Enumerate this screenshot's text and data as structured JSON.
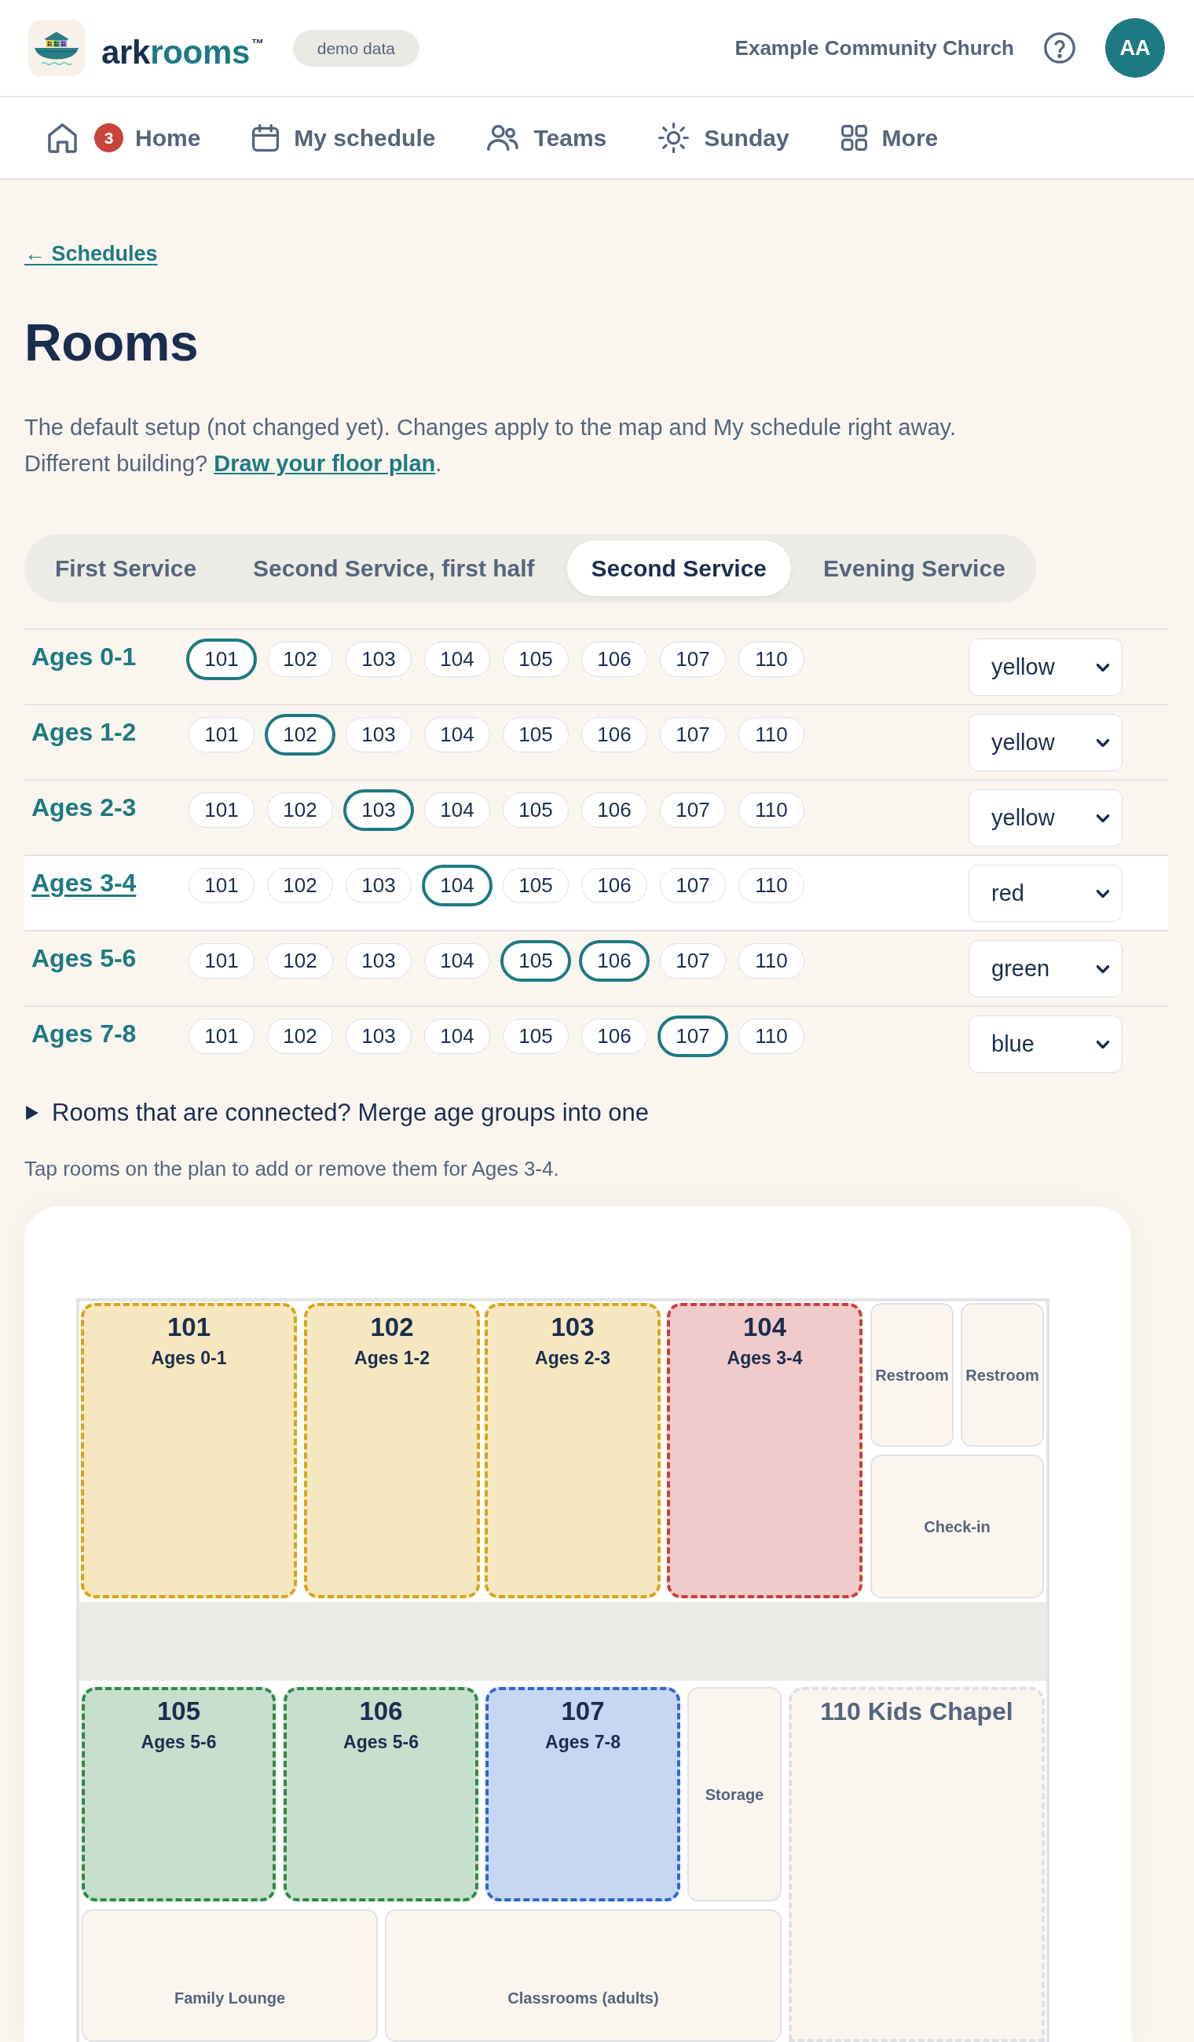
{
  "header": {
    "brand": {
      "first": "ark",
      "second": "rooms",
      "trademark": "™"
    },
    "mode_tag": "demo data",
    "organization": "Example Community Church",
    "avatar": "AA"
  },
  "nav": [
    {
      "kind": "home",
      "label": "Home",
      "badge": "3"
    },
    {
      "kind": "schedule",
      "label": "My schedule"
    },
    {
      "kind": "teams",
      "label": "Teams"
    },
    {
      "kind": "sunday",
      "label": "Sunday"
    },
    {
      "kind": "more",
      "label": "More"
    }
  ],
  "back_link": "← Schedules",
  "title": "Rooms",
  "description": {
    "sentence": "The default setup (not changed yet). Changes apply to the map and My schedule right away.",
    "question": "Different building?",
    "link": "Draw your floor plan",
    "end": "."
  },
  "service_tabs": [
    {
      "label": "First Service",
      "selected": false
    },
    {
      "label": "Second Service, first half",
      "selected": false
    },
    {
      "label": "Second Service",
      "selected": true
    },
    {
      "label": "Evening Service",
      "selected": false
    }
  ],
  "age_groups": [
    {
      "label": "Ages 0-1",
      "selected": false,
      "rooms": [
        {
          "number": "101",
          "selected": true
        },
        {
          "number": "102",
          "selected": false
        },
        {
          "number": "103",
          "selected": false
        },
        {
          "number": "104",
          "selected": false
        },
        {
          "number": "105",
          "selected": false
        },
        {
          "number": "106",
          "selected": false
        },
        {
          "number": "107",
          "selected": false
        },
        {
          "number": "110",
          "selected": false
        }
      ],
      "color_choice": "yellow"
    },
    {
      "label": "Ages 1-2",
      "selected": false,
      "rooms": [
        {
          "number": "101",
          "selected": false
        },
        {
          "number": "102",
          "selected": true
        },
        {
          "number": "103",
          "selected": false
        },
        {
          "number": "104",
          "selected": false
        },
        {
          "number": "105",
          "selected": false
        },
        {
          "number": "106",
          "selected": false
        },
        {
          "number": "107",
          "selected": false
        },
        {
          "number": "110",
          "selected": false
        }
      ],
      "color_choice": "yellow"
    },
    {
      "label": "Ages 2-3",
      "selected": false,
      "rooms": [
        {
          "number": "101",
          "selected": false
        },
        {
          "number": "102",
          "selected": false
        },
        {
          "number": "103",
          "selected": true
        },
        {
          "number": "104",
          "selected": false
        },
        {
          "number": "105",
          "selected": false
        },
        {
          "number": "106",
          "selected": false
        },
        {
          "number": "107",
          "selected": false
        },
        {
          "number": "110",
          "selected": false
        }
      ],
      "color_choice": "yellow"
    },
    {
      "label": "Ages 3-4",
      "selected": true,
      "rooms": [
        {
          "number": "101",
          "selected": false
        },
        {
          "number": "102",
          "selected": false
        },
        {
          "number": "103",
          "selected": false
        },
        {
          "number": "104",
          "selected": true
        },
        {
          "number": "105",
          "selected": false
        },
        {
          "number": "106",
          "selected": false
        },
        {
          "number": "107",
          "selected": false
        },
        {
          "number": "110",
          "selected": false
        }
      ],
      "color_choice": "red"
    },
    {
      "label": "Ages 5-6",
      "selected": false,
      "rooms": [
        {
          "number": "101",
          "selected": false
        },
        {
          "number": "102",
          "selected": false
        },
        {
          "number": "103",
          "selected": false
        },
        {
          "number": "104",
          "selected": false
        },
        {
          "number": "105",
          "selected": true
        },
        {
          "number": "106",
          "selected": true
        },
        {
          "number": "107",
          "selected": false
        },
        {
          "number": "110",
          "selected": false
        }
      ],
      "color_choice": "green"
    },
    {
      "label": "Ages 7-8",
      "selected": false,
      "rooms": [
        {
          "number": "101",
          "selected": false
        },
        {
          "number": "102",
          "selected": false
        },
        {
          "number": "103",
          "selected": false
        },
        {
          "number": "104",
          "selected": false
        },
        {
          "number": "105",
          "selected": false
        },
        {
          "number": "106",
          "selected": false
        },
        {
          "number": "107",
          "selected": true
        },
        {
          "number": "110",
          "selected": false
        }
      ],
      "color_choice": "blue"
    }
  ],
  "merge_toggle": {
    "label": "Rooms that are connected? Merge age groups into one",
    "expanded": false
  },
  "hint": "Tap rooms on the plan to add or remove them for Ages 3-4.",
  "floor_plan": {
    "rooms": [
      {
        "kind": "assigned",
        "number": "101",
        "group": "Ages 0-1",
        "color": "#d9a514"
      },
      {
        "kind": "assigned",
        "number": "102",
        "group": "Ages 1-2",
        "color": "#d9a514"
      },
      {
        "kind": "assigned",
        "number": "103",
        "group": "Ages 2-3",
        "color": "#d9a514"
      },
      {
        "kind": "assigned",
        "number": "104",
        "group": "Ages 3-4",
        "color": "#cc3d3d"
      },
      {
        "kind": "facility",
        "label": "Restroom"
      },
      {
        "kind": "facility",
        "label": "Restroom"
      },
      {
        "kind": "facility",
        "label": "Check-in"
      },
      {
        "kind": "assigned",
        "number": "105",
        "group": "Ages 5-6",
        "color": "#2e8a45"
      },
      {
        "kind": "assigned",
        "number": "106",
        "group": "Ages 5-6",
        "color": "#2e8a45"
      },
      {
        "kind": "assigned",
        "number": "107",
        "group": "Ages 7-8",
        "color": "#2f66d0"
      },
      {
        "kind": "facility",
        "label": "Storage"
      },
      {
        "kind": "open",
        "label": "110 Kids Chapel"
      },
      {
        "kind": "facility",
        "label": "Family Lounge"
      },
      {
        "kind": "facility",
        "label": "Classrooms (adults)"
      }
    ]
  }
}
